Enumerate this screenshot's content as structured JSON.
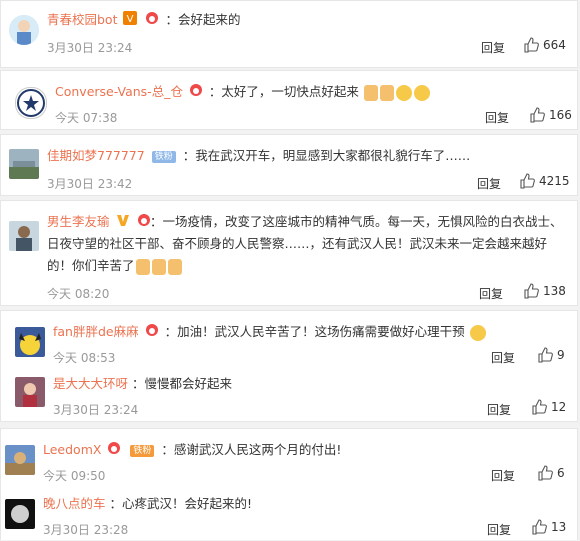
{
  "comments": [
    {
      "name": "青春校园bot",
      "text": "：会好起来的",
      "time": "3月30日 23:24",
      "reply": "回复",
      "likes": "664"
    },
    {
      "name": "Converse-Vans-总_仓",
      "text": "：太好了，一切快点好起来",
      "time": "今天 07:38",
      "reply": "回复",
      "likes": "166"
    },
    {
      "name": "佳期如梦777777",
      "fan_badge": "铁粉",
      "text": "：我在武汉开车，明显感到大家都很礼貌行车了……",
      "time": "3月30日 23:42",
      "reply": "回复",
      "likes": "4215"
    },
    {
      "name": "男生李友瑜",
      "text": "：一场疫情，改变了这座城市的精神气质。每一天，无惧风险的白衣战士、日夜守望的社区干部、奋不顾身的人民警察……，还有武汉人民！武汉未来一定会越来越好的！你们辛苦了",
      "time": "今天 08:20",
      "reply": "回复",
      "likes": "138"
    },
    {
      "name": "fan胖胖de麻麻",
      "text": "：加油！武汉人民辛苦了！这场伤痛需要做好心理干预",
      "time": "今天 08:53",
      "reply": "回复",
      "likes": "9"
    },
    {
      "name": "是大大大环呀",
      "text": "：慢慢都会好起来",
      "time": "3月30日 23:24",
      "reply": "回复",
      "likes": "12"
    },
    {
      "name": "LeedomX",
      "fan_badge": "铁粉",
      "text": "：感谢武汉人民这两个月的付出!",
      "time": "今天 09:50",
      "reply": "回复",
      "likes": "6"
    },
    {
      "name": "晚八点的车",
      "text": "：心疼武汉！会好起来的!",
      "time": "3月30日 23:28",
      "reply": "回复",
      "likes": "13"
    }
  ],
  "colors": {
    "name": "#eb7350",
    "time": "#999999",
    "bg": "#f2f2f2"
  }
}
